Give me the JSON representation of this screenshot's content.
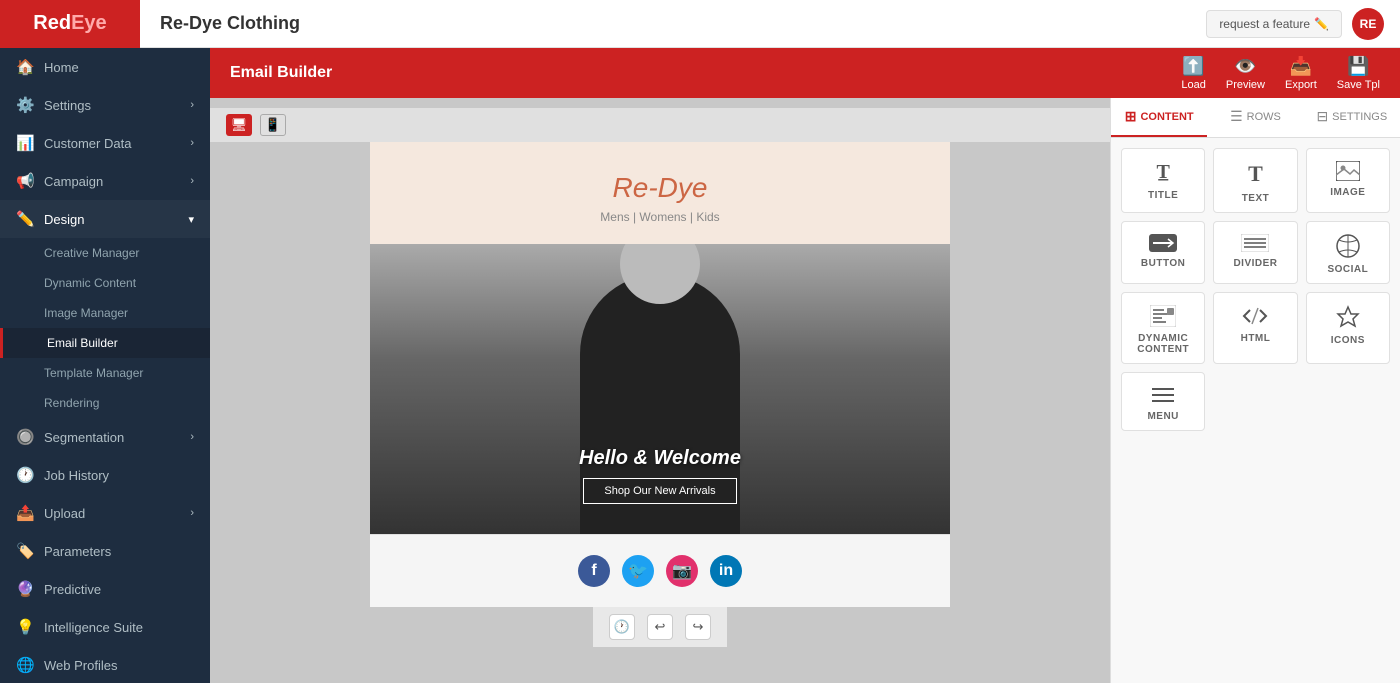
{
  "topbar": {
    "logo": "RedEye",
    "page_title": "Re-Dye Clothing",
    "request_feature_label": "request a feature",
    "user_initials": "RE"
  },
  "sidebar": {
    "items": [
      {
        "id": "home",
        "label": "Home",
        "icon": "🏠",
        "has_sub": false
      },
      {
        "id": "settings",
        "label": "Settings",
        "icon": "⚙️",
        "has_sub": true
      },
      {
        "id": "customer-data",
        "label": "Customer Data",
        "icon": "📊",
        "has_sub": true
      },
      {
        "id": "campaign",
        "label": "Campaign",
        "icon": "📢",
        "has_sub": true
      },
      {
        "id": "design",
        "label": "Design",
        "icon": "✏️",
        "has_sub": true,
        "active": true
      }
    ],
    "design_sub_items": [
      {
        "id": "creative-manager",
        "label": "Creative Manager"
      },
      {
        "id": "dynamic-content",
        "label": "Dynamic Content"
      },
      {
        "id": "image-manager",
        "label": "Image Manager"
      },
      {
        "id": "email-builder",
        "label": "Email Builder",
        "active": true
      },
      {
        "id": "template-manager",
        "label": "Template Manager"
      },
      {
        "id": "rendering",
        "label": "Rendering"
      }
    ],
    "bottom_items": [
      {
        "id": "segmentation",
        "label": "Segmentation",
        "icon": "🔘",
        "has_sub": true
      },
      {
        "id": "job-history",
        "label": "Job History",
        "icon": "🕐",
        "has_sub": false
      },
      {
        "id": "upload",
        "label": "Upload",
        "icon": "📤",
        "has_sub": true
      },
      {
        "id": "parameters",
        "label": "Parameters",
        "icon": "🏷️",
        "has_sub": false
      },
      {
        "id": "predictive",
        "label": "Predictive",
        "icon": "🔮",
        "has_sub": false
      },
      {
        "id": "intelligence-suite",
        "label": "Intelligence Suite",
        "icon": "💡",
        "has_sub": false
      },
      {
        "id": "web-profiles",
        "label": "Web Profiles",
        "icon": "🌐",
        "has_sub": false
      }
    ]
  },
  "email_builder": {
    "title": "Email Builder",
    "toolbar": {
      "load_label": "Load",
      "preview_label": "Preview",
      "export_label": "Export",
      "save_label": "Save Tpl"
    },
    "canvas": {
      "email_logo": "Re-Dye",
      "email_nav": "Mens | Womens | Kids",
      "hero_greeting": "Hello & Welcome",
      "hero_cta": "Shop Our New Arrivals"
    }
  },
  "right_panel": {
    "tabs": [
      {
        "id": "content",
        "label": "CONTENT",
        "active": true
      },
      {
        "id": "rows",
        "label": "ROWS"
      },
      {
        "id": "settings",
        "label": "SETTINGS"
      }
    ],
    "content_blocks": [
      {
        "id": "title",
        "label": "TITLE",
        "icon": "title"
      },
      {
        "id": "text",
        "label": "TEXT",
        "icon": "text"
      },
      {
        "id": "image",
        "label": "IMAGE",
        "icon": "image"
      },
      {
        "id": "button",
        "label": "BUTTON",
        "icon": "button"
      },
      {
        "id": "divider",
        "label": "DIVIDER",
        "icon": "divider"
      },
      {
        "id": "social",
        "label": "SOCIAL",
        "icon": "social"
      },
      {
        "id": "dynamic-content",
        "label": "DYNAMIC CONTENT",
        "icon": "dynamic"
      },
      {
        "id": "html",
        "label": "HTML",
        "icon": "html"
      },
      {
        "id": "icons",
        "label": "ICONS",
        "icon": "icons"
      },
      {
        "id": "menu",
        "label": "MENU",
        "icon": "menu"
      }
    ]
  },
  "colors": {
    "brand_red": "#cc2222",
    "sidebar_bg": "#1e2d40",
    "top_bar_bg": "#ffffff"
  }
}
